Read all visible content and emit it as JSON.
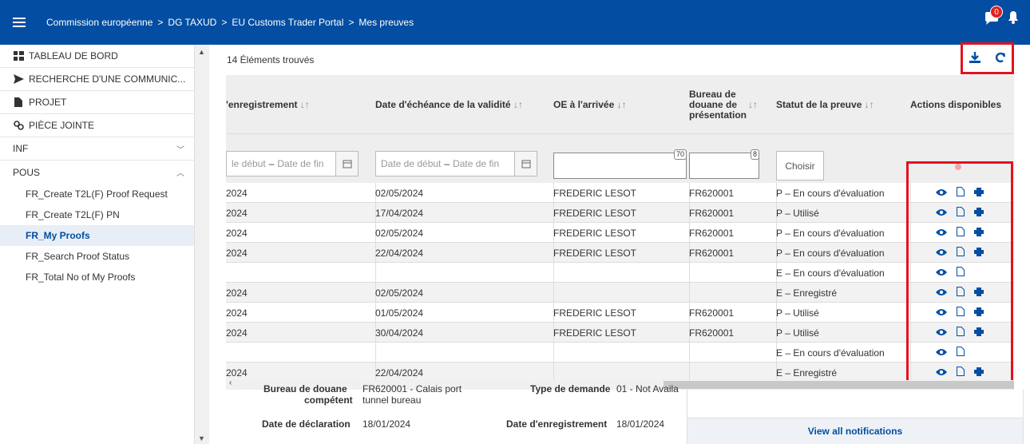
{
  "topbar": {
    "breadcrumb": [
      "Commission européenne",
      "DG TAXUD",
      "EU Customs Trader Portal",
      "Mes preuves"
    ],
    "separator": ">",
    "chat_badge": "0"
  },
  "sidebar": {
    "items": [
      {
        "label": "TABLEAU DE BORD",
        "icon": "dashboard-icon"
      },
      {
        "label": "RECHERCHE D'UNE COMMUNIC...",
        "icon": "send-icon"
      },
      {
        "label": "PROJET",
        "icon": "file-icon"
      },
      {
        "label": "PIÈCE JOINTE",
        "icon": "attachment-icon"
      },
      {
        "label": "INF",
        "chevron": "﹀"
      },
      {
        "label": "POUS",
        "chevron": "︿"
      }
    ],
    "subitems": [
      "FR_Create T2L(F) Proof Request",
      "FR_Create T2L(F) PN",
      "FR_My Proofs",
      "FR_Search Proof Status",
      "FR_Total No of My Proofs"
    ],
    "active_subitem": "FR_My Proofs"
  },
  "main": {
    "results": "14 Éléments trouvés",
    "headers": {
      "enregistrement": "'enregistrement",
      "echeance": "Date d'échéance de la validité",
      "oe": "OE à l'arrivée",
      "bureau": "Bureau de douane de présentation",
      "statut": "Statut de la preuve",
      "actions": "Actions disponibles",
      "sort_glyph": "↓↑"
    },
    "filters": {
      "date_start": "Date de début",
      "date_end": "Date de fin",
      "date_start_partial": "le début",
      "dash": "–",
      "oe_counter": "70",
      "bureau_counter": "8",
      "choose": "Choisir"
    },
    "rows": [
      {
        "enr": "2024",
        "ech": "02/05/2024",
        "oe": "FREDERIC LESOT",
        "bur": "FR620001",
        "stat": "P – En cours d'évaluation",
        "print": true
      },
      {
        "enr": "2024",
        "ech": "17/04/2024",
        "oe": "FREDERIC LESOT",
        "bur": "FR620001",
        "stat": "P – Utilisé",
        "print": true
      },
      {
        "enr": "2024",
        "ech": "02/05/2024",
        "oe": "FREDERIC LESOT",
        "bur": "FR620001",
        "stat": "P – En cours d'évaluation",
        "print": true
      },
      {
        "enr": "2024",
        "ech": "22/04/2024",
        "oe": "FREDERIC LESOT",
        "bur": "FR620001",
        "stat": "P – En cours d'évaluation",
        "print": true
      },
      {
        "enr": "",
        "ech": "",
        "oe": "",
        "bur": "",
        "stat": "E – En cours d'évaluation",
        "print": false
      },
      {
        "enr": "2024",
        "ech": "02/05/2024",
        "oe": "",
        "bur": "",
        "stat": "E – Enregistré",
        "print": true
      },
      {
        "enr": "2024",
        "ech": "01/05/2024",
        "oe": "FREDERIC LESOT",
        "bur": "FR620001",
        "stat": "P – Utilisé",
        "print": true
      },
      {
        "enr": "2024",
        "ech": "30/04/2024",
        "oe": "FREDERIC LESOT",
        "bur": "FR620001",
        "stat": "P – Utilisé",
        "print": true
      },
      {
        "enr": "",
        "ech": "",
        "oe": "",
        "bur": "",
        "stat": "E – En cours d'évaluation",
        "print": false
      },
      {
        "enr": "2024",
        "ech": "22/04/2024",
        "oe": "",
        "bur": "",
        "stat": "E – Enregistré",
        "print": true
      }
    ]
  },
  "below": {
    "bureau_label": "Bureau de douane",
    "competent_label": "compétent",
    "bureau_value": "FR620001 - Calais port",
    "bureau_value2": "tunnel bureau",
    "type_label": "Type de demande",
    "type_value": "01 - Not Availa",
    "decl_label": "Date de déclaration",
    "decl_value": "18/01/2024",
    "enr_label": "Date d'enregistrement",
    "enr_value": "18/01/2024"
  },
  "notifications": {
    "button": "View all notifications"
  },
  "colors": {
    "brand": "#034ea2",
    "highlight": "#e0141e"
  }
}
